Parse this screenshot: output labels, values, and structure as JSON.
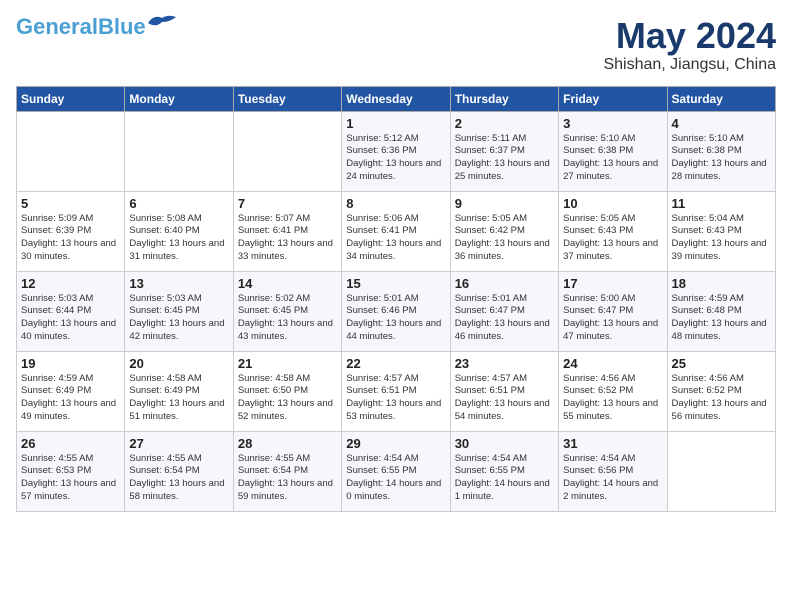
{
  "header": {
    "logo_line1": "General",
    "logo_line2": "Blue",
    "month": "May 2024",
    "location": "Shishan, Jiangsu, China"
  },
  "weekdays": [
    "Sunday",
    "Monday",
    "Tuesday",
    "Wednesday",
    "Thursday",
    "Friday",
    "Saturday"
  ],
  "weeks": [
    [
      {
        "day": "",
        "info": ""
      },
      {
        "day": "",
        "info": ""
      },
      {
        "day": "",
        "info": ""
      },
      {
        "day": "1",
        "info": "Sunrise: 5:12 AM\nSunset: 6:36 PM\nDaylight: 13 hours and 24 minutes."
      },
      {
        "day": "2",
        "info": "Sunrise: 5:11 AM\nSunset: 6:37 PM\nDaylight: 13 hours and 25 minutes."
      },
      {
        "day": "3",
        "info": "Sunrise: 5:10 AM\nSunset: 6:38 PM\nDaylight: 13 hours and 27 minutes."
      },
      {
        "day": "4",
        "info": "Sunrise: 5:10 AM\nSunset: 6:38 PM\nDaylight: 13 hours and 28 minutes."
      }
    ],
    [
      {
        "day": "5",
        "info": "Sunrise: 5:09 AM\nSunset: 6:39 PM\nDaylight: 13 hours and 30 minutes."
      },
      {
        "day": "6",
        "info": "Sunrise: 5:08 AM\nSunset: 6:40 PM\nDaylight: 13 hours and 31 minutes."
      },
      {
        "day": "7",
        "info": "Sunrise: 5:07 AM\nSunset: 6:41 PM\nDaylight: 13 hours and 33 minutes."
      },
      {
        "day": "8",
        "info": "Sunrise: 5:06 AM\nSunset: 6:41 PM\nDaylight: 13 hours and 34 minutes."
      },
      {
        "day": "9",
        "info": "Sunrise: 5:05 AM\nSunset: 6:42 PM\nDaylight: 13 hours and 36 minutes."
      },
      {
        "day": "10",
        "info": "Sunrise: 5:05 AM\nSunset: 6:43 PM\nDaylight: 13 hours and 37 minutes."
      },
      {
        "day": "11",
        "info": "Sunrise: 5:04 AM\nSunset: 6:43 PM\nDaylight: 13 hours and 39 minutes."
      }
    ],
    [
      {
        "day": "12",
        "info": "Sunrise: 5:03 AM\nSunset: 6:44 PM\nDaylight: 13 hours and 40 minutes."
      },
      {
        "day": "13",
        "info": "Sunrise: 5:03 AM\nSunset: 6:45 PM\nDaylight: 13 hours and 42 minutes."
      },
      {
        "day": "14",
        "info": "Sunrise: 5:02 AM\nSunset: 6:45 PM\nDaylight: 13 hours and 43 minutes."
      },
      {
        "day": "15",
        "info": "Sunrise: 5:01 AM\nSunset: 6:46 PM\nDaylight: 13 hours and 44 minutes."
      },
      {
        "day": "16",
        "info": "Sunrise: 5:01 AM\nSunset: 6:47 PM\nDaylight: 13 hours and 46 minutes."
      },
      {
        "day": "17",
        "info": "Sunrise: 5:00 AM\nSunset: 6:47 PM\nDaylight: 13 hours and 47 minutes."
      },
      {
        "day": "18",
        "info": "Sunrise: 4:59 AM\nSunset: 6:48 PM\nDaylight: 13 hours and 48 minutes."
      }
    ],
    [
      {
        "day": "19",
        "info": "Sunrise: 4:59 AM\nSunset: 6:49 PM\nDaylight: 13 hours and 49 minutes."
      },
      {
        "day": "20",
        "info": "Sunrise: 4:58 AM\nSunset: 6:49 PM\nDaylight: 13 hours and 51 minutes."
      },
      {
        "day": "21",
        "info": "Sunrise: 4:58 AM\nSunset: 6:50 PM\nDaylight: 13 hours and 52 minutes."
      },
      {
        "day": "22",
        "info": "Sunrise: 4:57 AM\nSunset: 6:51 PM\nDaylight: 13 hours and 53 minutes."
      },
      {
        "day": "23",
        "info": "Sunrise: 4:57 AM\nSunset: 6:51 PM\nDaylight: 13 hours and 54 minutes."
      },
      {
        "day": "24",
        "info": "Sunrise: 4:56 AM\nSunset: 6:52 PM\nDaylight: 13 hours and 55 minutes."
      },
      {
        "day": "25",
        "info": "Sunrise: 4:56 AM\nSunset: 6:52 PM\nDaylight: 13 hours and 56 minutes."
      }
    ],
    [
      {
        "day": "26",
        "info": "Sunrise: 4:55 AM\nSunset: 6:53 PM\nDaylight: 13 hours and 57 minutes."
      },
      {
        "day": "27",
        "info": "Sunrise: 4:55 AM\nSunset: 6:54 PM\nDaylight: 13 hours and 58 minutes."
      },
      {
        "day": "28",
        "info": "Sunrise: 4:55 AM\nSunset: 6:54 PM\nDaylight: 13 hours and 59 minutes."
      },
      {
        "day": "29",
        "info": "Sunrise: 4:54 AM\nSunset: 6:55 PM\nDaylight: 14 hours and 0 minutes."
      },
      {
        "day": "30",
        "info": "Sunrise: 4:54 AM\nSunset: 6:55 PM\nDaylight: 14 hours and 1 minute."
      },
      {
        "day": "31",
        "info": "Sunrise: 4:54 AM\nSunset: 6:56 PM\nDaylight: 14 hours and 2 minutes."
      },
      {
        "day": "",
        "info": ""
      }
    ]
  ]
}
